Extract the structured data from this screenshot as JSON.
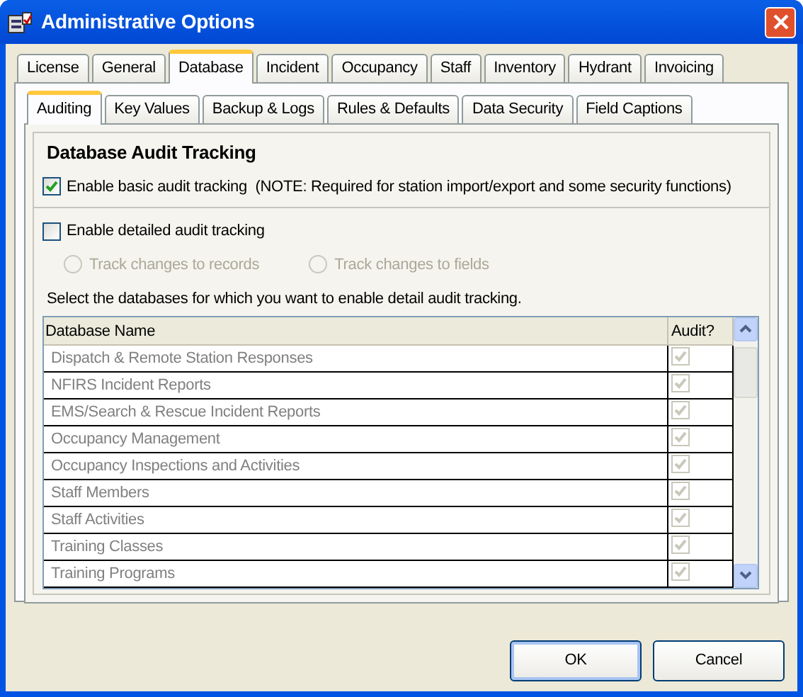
{
  "window": {
    "title": "Administrative Options"
  },
  "tabs": [
    {
      "label": "License",
      "selected": false
    },
    {
      "label": "General",
      "selected": false
    },
    {
      "label": "Database",
      "selected": true
    },
    {
      "label": "Incident",
      "selected": false
    },
    {
      "label": "Occupancy",
      "selected": false
    },
    {
      "label": "Staff",
      "selected": false
    },
    {
      "label": "Inventory",
      "selected": false
    },
    {
      "label": "Hydrant",
      "selected": false
    },
    {
      "label": "Invoicing",
      "selected": false
    }
  ],
  "subtabs": [
    {
      "label": "Auditing",
      "selected": true
    },
    {
      "label": "Key Values",
      "selected": false
    },
    {
      "label": "Backup & Logs",
      "selected": false
    },
    {
      "label": "Rules & Defaults",
      "selected": false
    },
    {
      "label": "Data Security",
      "selected": false
    },
    {
      "label": "Field Captions",
      "selected": false
    }
  ],
  "group": {
    "title": "Database Audit Tracking",
    "basic": {
      "label": "Enable basic audit tracking  (NOTE: Required for station import/export and some security functions)",
      "checked": true
    }
  },
  "detailed": {
    "label": "Enable detailed audit tracking",
    "checked": false
  },
  "track_options": [
    {
      "label": "Track changes to records",
      "selected": false,
      "disabled": true
    },
    {
      "label": "Track changes to fields",
      "selected": false,
      "disabled": true
    }
  ],
  "instructions": "Select the databases for which you want to enable detail audit tracking.",
  "table": {
    "columns": [
      "Database Name",
      "Audit?"
    ],
    "rows": [
      {
        "name": "Dispatch & Remote Station Responses",
        "checked": true,
        "disabled": true
      },
      {
        "name": "NFIRS Incident Reports",
        "checked": true,
        "disabled": true
      },
      {
        "name": "EMS/Search & Rescue Incident Reports",
        "checked": true,
        "disabled": true
      },
      {
        "name": "Occupancy Management",
        "checked": true,
        "disabled": true
      },
      {
        "name": "Occupancy Inspections and Activities",
        "checked": true,
        "disabled": true
      },
      {
        "name": "Staff Members",
        "checked": true,
        "disabled": true
      },
      {
        "name": "Staff Activities",
        "checked": true,
        "disabled": true
      },
      {
        "name": "Training Classes",
        "checked": true,
        "disabled": true
      },
      {
        "name": "Training Programs",
        "checked": true,
        "disabled": true
      }
    ]
  },
  "buttons": [
    "OK",
    "Cancel"
  ]
}
